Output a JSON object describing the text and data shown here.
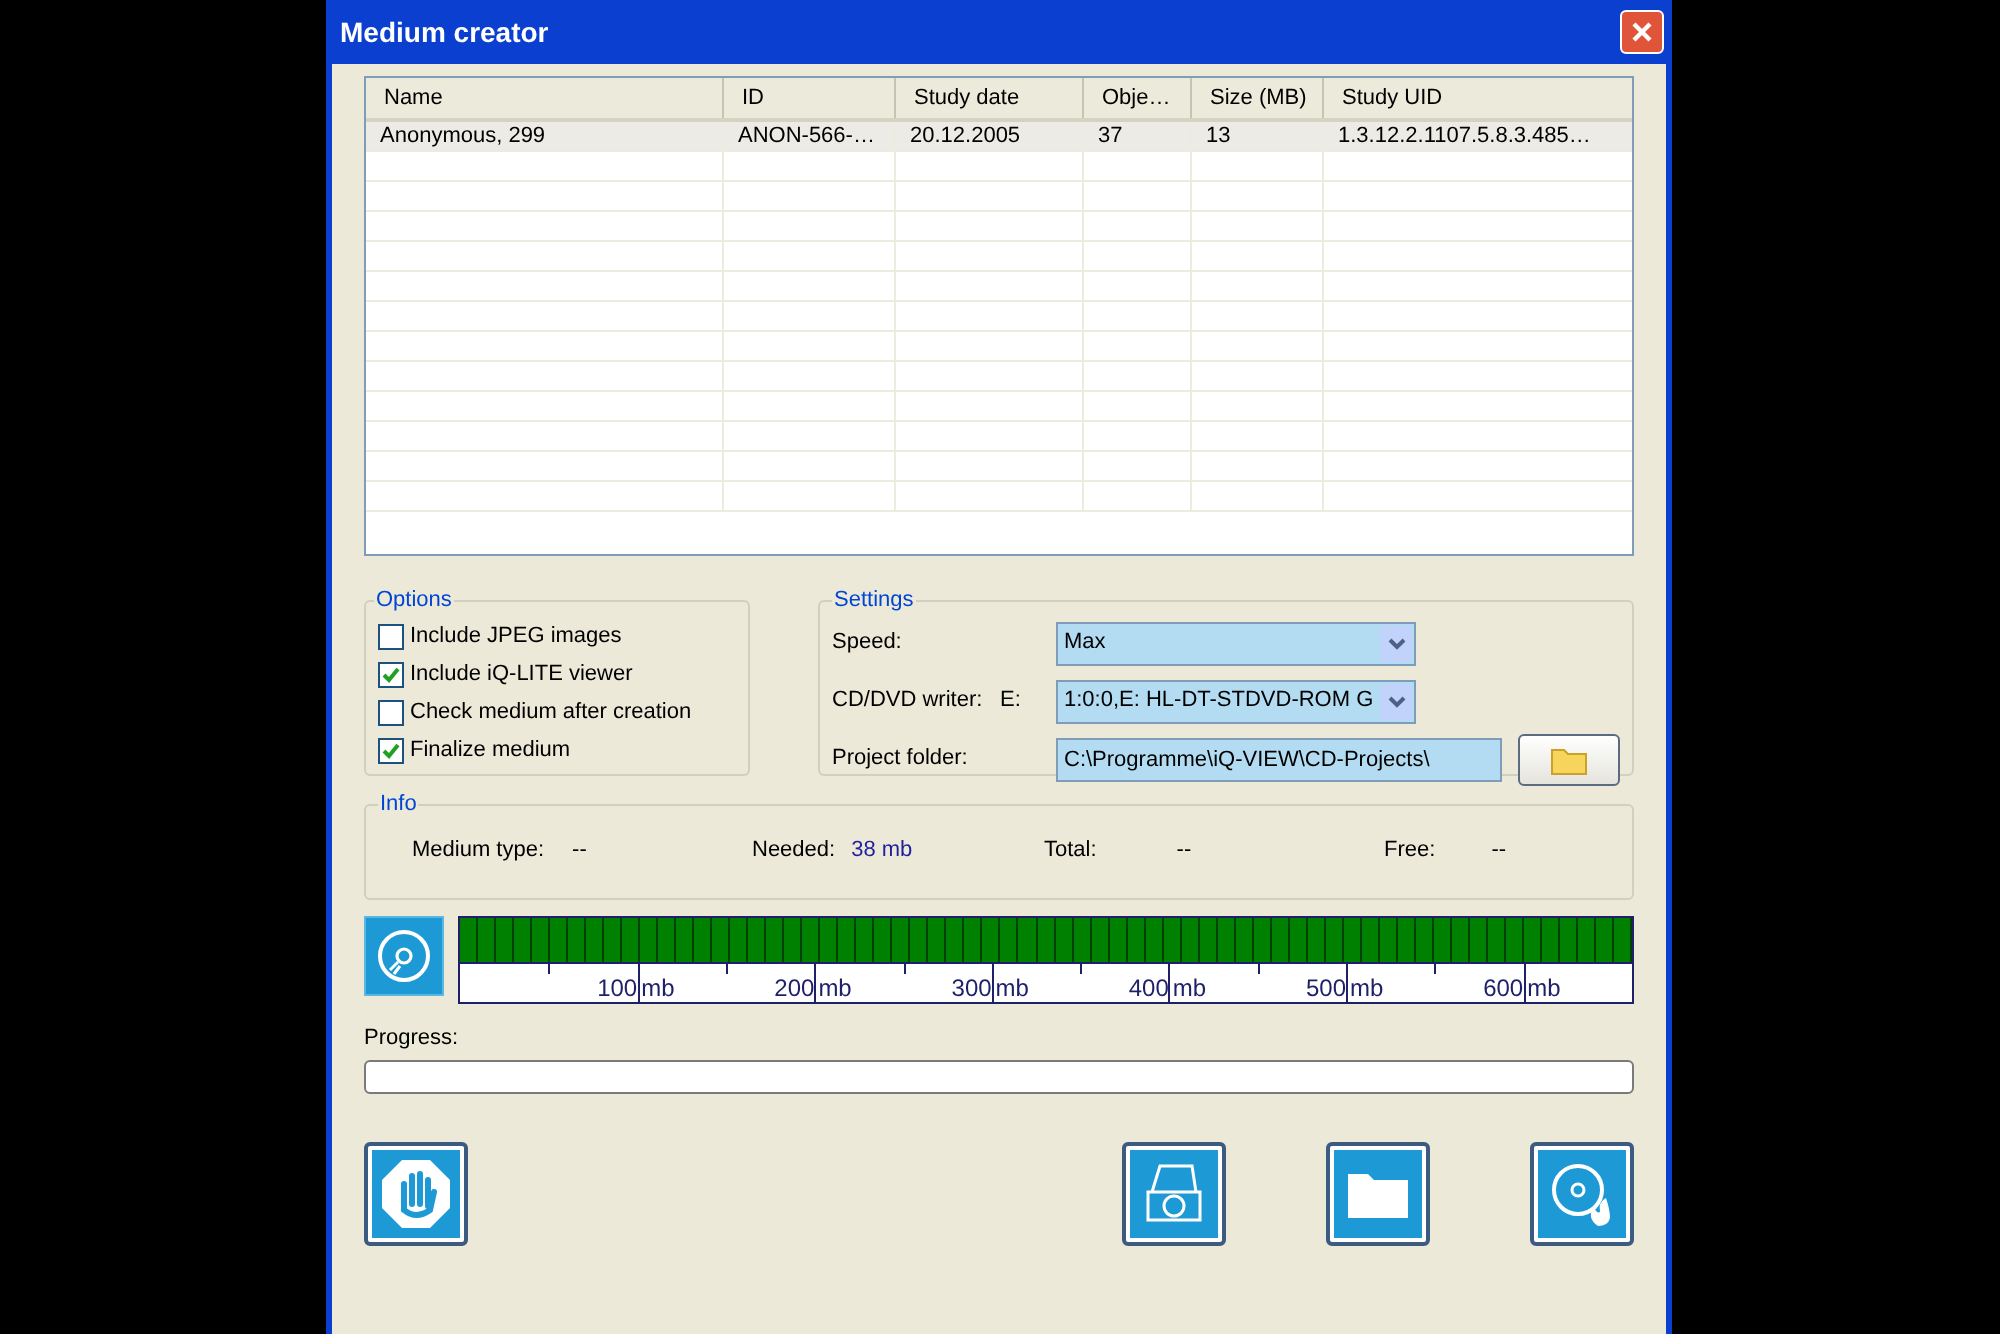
{
  "window": {
    "title": "Medium creator"
  },
  "table": {
    "columns": [
      "Name",
      "ID",
      "Study date",
      "Obje…",
      "Size (MB)",
      "Study UID"
    ],
    "rows": [
      {
        "cells": [
          "Anonymous, 299",
          "ANON-566-…",
          "20.12.2005",
          "37",
          "13",
          "1.3.12.2.1107.5.8.3.485…"
        ],
        "selected": false
      }
    ]
  },
  "options": {
    "title": "Options",
    "items": [
      {
        "label": "Include JPEG images",
        "checked": false
      },
      {
        "label": "Include iQ-LITE viewer",
        "checked": true
      },
      {
        "label": "Check medium after creation",
        "checked": false
      },
      {
        "label": "Finalize medium",
        "checked": true
      }
    ]
  },
  "settings": {
    "title": "Settings",
    "speed": {
      "label": "Speed:",
      "value": "Max"
    },
    "writer": {
      "label": "CD/DVD writer:",
      "drive": "E:",
      "value": "1:0:0,E: HL-DT-STDVD-ROM G"
    },
    "project_folder": {
      "label": "Project folder:",
      "value": "C:\\Programme\\iQ-VIEW\\CD-Projects\\"
    }
  },
  "info": {
    "title": "Info",
    "fields": [
      {
        "label": "Medium type:",
        "value": "--"
      },
      {
        "label": "Needed:",
        "value": "38 mb"
      },
      {
        "label": "Total:",
        "value": "--"
      },
      {
        "label": "Free:",
        "value": "--"
      }
    ]
  },
  "capacity_scale": [
    {
      "value": "100",
      "unit": "mb"
    },
    {
      "value": "200",
      "unit": "mb"
    },
    {
      "value": "300",
      "unit": "mb"
    },
    {
      "value": "400",
      "unit": "mb"
    },
    {
      "value": "500",
      "unit": "mb"
    },
    {
      "value": "600",
      "unit": "mb"
    }
  ],
  "progress": {
    "label": "Progress:",
    "level": 0
  }
}
